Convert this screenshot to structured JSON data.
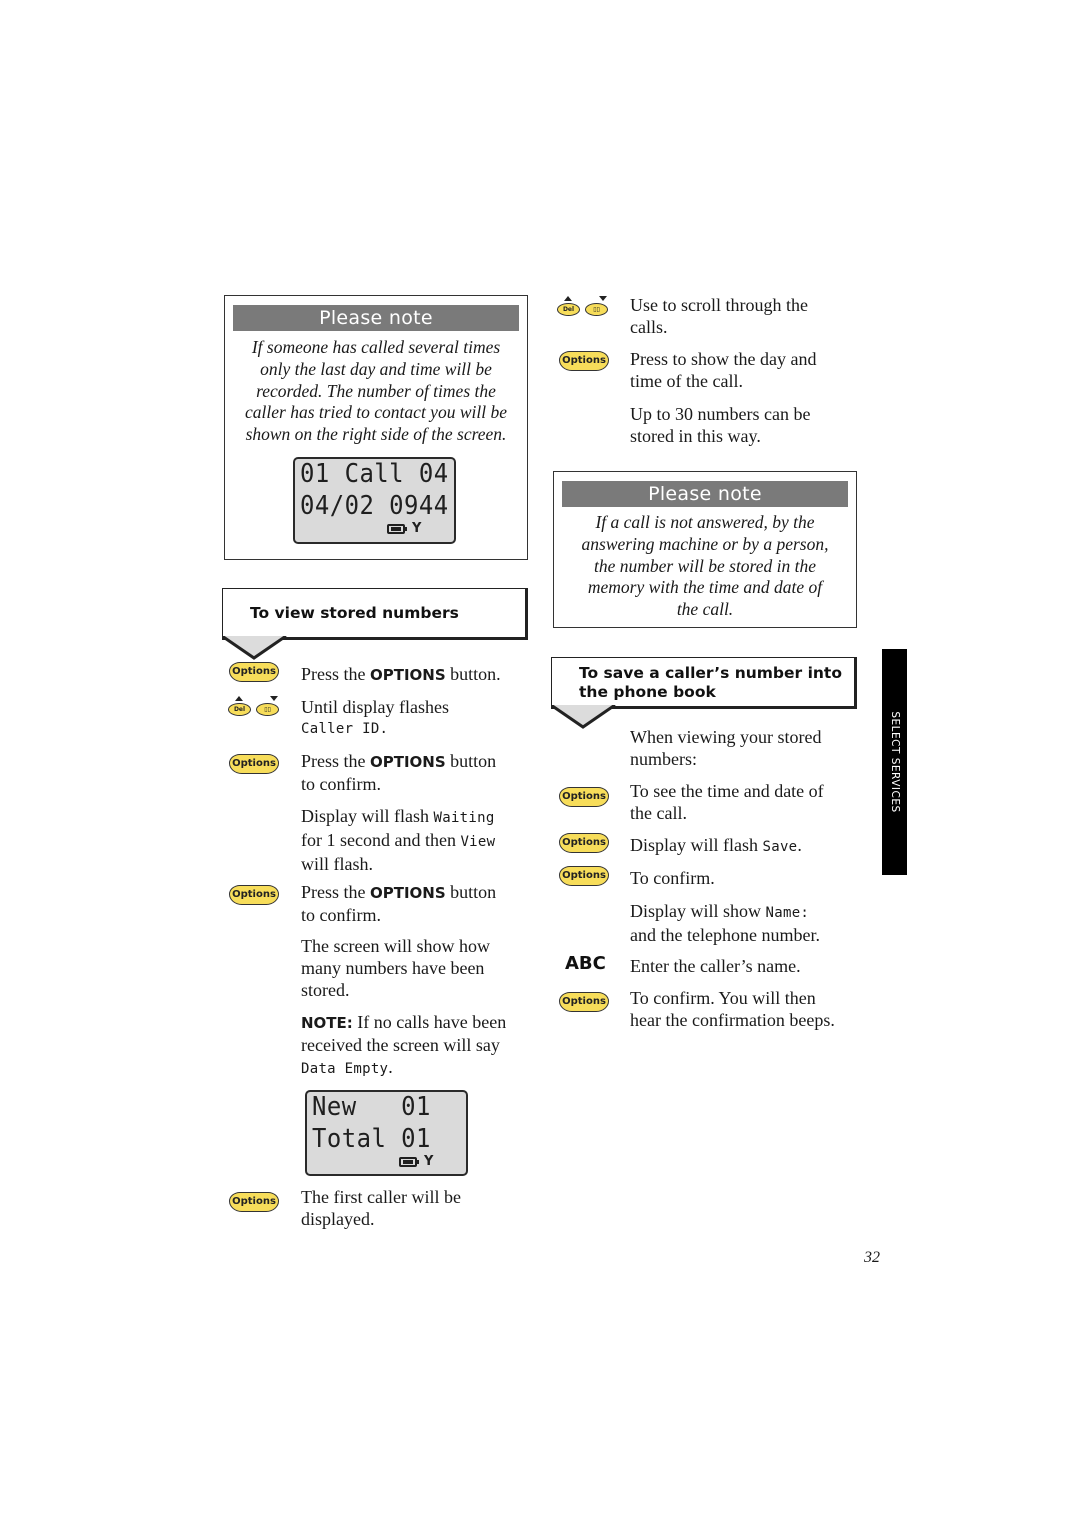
{
  "left_note": {
    "header": "Please note",
    "lines": [
      "If someone has called several times",
      "only the last day and time will be",
      "recorded. The number of times the",
      "caller has tried to contact you will be",
      "shown on the right side of the screen."
    ],
    "display": {
      "line1": "01 Call 04",
      "line2": "04/02 0944",
      "icons": [
        "battery-icon",
        "signal-icon"
      ]
    }
  },
  "view_section": {
    "title": "To view stored numbers",
    "steps": [
      {
        "icon": "options-button",
        "icon_label": "Options",
        "pre": "Press the ",
        "bold": "OPTIONS",
        "post": " button."
      },
      {
        "icon": "scroll-keys",
        "key_left": "Del",
        "line1": "Until display flashes",
        "lcd": "Caller ID."
      },
      {
        "icon": "options-button",
        "icon_label": "Options",
        "pre": "Press the ",
        "bold": "OPTIONS",
        "post": " button",
        "line2": "to confirm."
      },
      {
        "icon": "none",
        "pre": "Display will flash ",
        "lcd1": "Waiting",
        "mid": "for 1 second and then ",
        "lcd2": "View",
        "post": "will flash."
      },
      {
        "icon": "options-button",
        "icon_label": "Options",
        "pre": "Press the ",
        "bold": "OPTIONS",
        "post": " button",
        "line2": "to confirm."
      },
      {
        "icon": "none",
        "lines": [
          "The screen will show how",
          "many numbers have been",
          "stored."
        ]
      },
      {
        "icon": "none",
        "bold": "NOTE:",
        "line1": " If no calls have been",
        "line2": "received the screen will say",
        "lcd": "Data Empty",
        "tail": "."
      }
    ],
    "display": {
      "line1": "New   01",
      "line2": "Total 01",
      "icons": [
        "battery-icon",
        "signal-icon"
      ]
    },
    "final_step": {
      "icon": "options-button",
      "icon_label": "Options",
      "lines": [
        "The first caller will be",
        "displayed."
      ]
    }
  },
  "scroll_section": {
    "steps": [
      {
        "icon": "scroll-keys",
        "key_left": "Del",
        "lines": [
          "Use to scroll through the",
          "calls."
        ]
      },
      {
        "icon": "options-button",
        "icon_label": "Options",
        "lines": [
          "Press to show the day and",
          "time of the call."
        ]
      },
      {
        "icon": "none",
        "lines": [
          "Up to 30 numbers can be",
          "stored in this way."
        ]
      }
    ]
  },
  "right_note": {
    "header": "Please note",
    "lines": [
      "If a call is not answered, by the",
      "answering machine or by a person,",
      "the number will be stored in the",
      "memory with the time and date of",
      "the call."
    ]
  },
  "save_section": {
    "title_line1": "To save a caller’s number into",
    "title_line2": "the phone book",
    "steps": [
      {
        "icon": "none",
        "lines": [
          "When viewing your stored",
          "numbers:"
        ]
      },
      {
        "icon": "options-button",
        "icon_label": "Options",
        "lines": [
          "To see the time and date of",
          "the call."
        ]
      },
      {
        "icon": "options-button",
        "icon_label": "Options",
        "pre": "Display will flash ",
        "lcd": "Save",
        "post": "."
      },
      {
        "icon": "options-button",
        "icon_label": "Options",
        "lines": [
          "To confirm."
        ]
      },
      {
        "icon": "none",
        "pre": "Display will show ",
        "lcd": "Name:",
        "line2": "and the telephone number."
      },
      {
        "icon": "abc-key",
        "icon_label": "ABC",
        "lines": [
          "Enter the caller’s name."
        ]
      },
      {
        "icon": "options-button",
        "icon_label": "Options",
        "lines": [
          "To confirm. You will then",
          "hear the confirmation beeps."
        ]
      }
    ]
  },
  "side_tab": "SELECT SERVICES",
  "page_number": "32",
  "colors": {
    "key_yellow": "#f7dd5a",
    "note_header": "#7a7a7a",
    "icon_column": "#dcdcdc",
    "lcd_bg": "#dadada"
  }
}
